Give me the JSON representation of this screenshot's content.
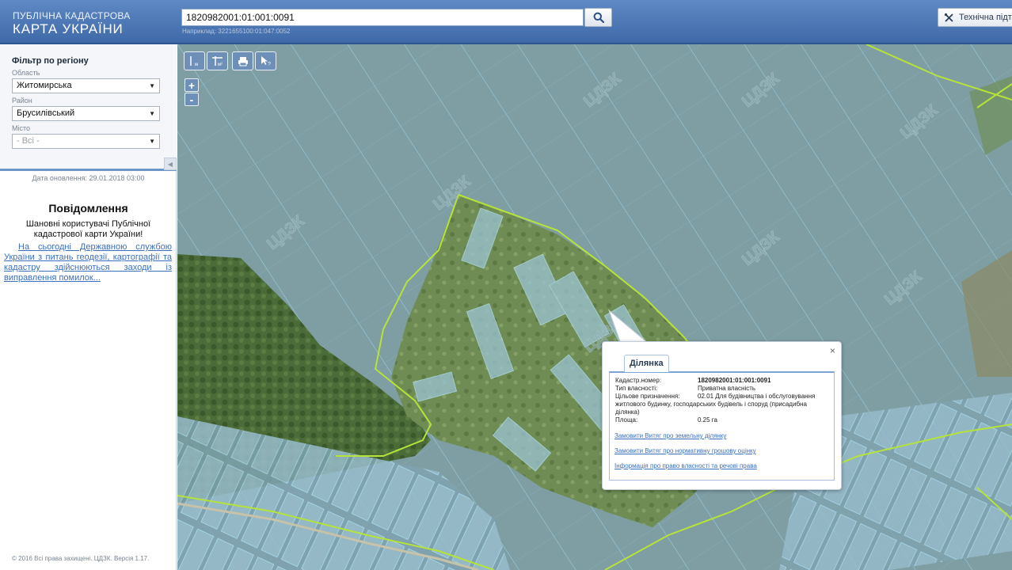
{
  "header": {
    "logo_line1": "ПУБЛІЧНА КАДАСТРОВА",
    "logo_line2": "КАРТА УКРАЇНИ",
    "search_value": "1820982001:01:001:0091",
    "search_hint": "Наприклад: 3221655100:01:047:0052",
    "search_icon": "search-icon",
    "support_label": "Технічна підтр",
    "support_icon": "tools-icon"
  },
  "sidebar": {
    "filter_title": "Фільтр по регіону",
    "region_label": "Область",
    "region_value": "Житомирська",
    "district_label": "Район",
    "district_value": "Брусилівський",
    "city_label": "Місто",
    "city_value": "- Всі -",
    "update_date": "Дата оновлення: 29.01.2018 03:00",
    "notice_title": "Повідомлення",
    "notice_text": "Шановні користувачі Публічної кадастрової карти України!",
    "notice_link": "На сьогодні Державною службою України з питань геодезії, картографії та кадастру здійснюються заходи із виправлення помилок...",
    "copyright": "© 2016 Всі права захищені. ЦДЗК. Версія 1.17."
  },
  "map": {
    "toolbar": [
      "ruler-icon",
      "area-ruler-icon",
      "print-icon",
      "identify-icon"
    ],
    "zoom_in": "+",
    "zoom_out": "-",
    "watermark": "ЦДЗК"
  },
  "popup": {
    "tab": "Ділянка",
    "close": "×",
    "cadastral_label": "Кадастр.номер:",
    "cadastral_value": "1820982001:01:001:0091",
    "ownership_label": "Тип власності:",
    "ownership_value": "Приватна власність",
    "purpose_label": "Цільове призначення:",
    "purpose_value": "02.01 Для будівництва і обслуговування житлового будинку, господарських будівель і споруд (присадибна ділянка)",
    "area_label": "Площа:",
    "area_value": "0.25 га",
    "links": [
      "Замовити Витяг про земельну ділянку",
      "Замовити Витяг про нормативну грошову оцінку",
      "Інформація про право власності та речові права"
    ]
  }
}
